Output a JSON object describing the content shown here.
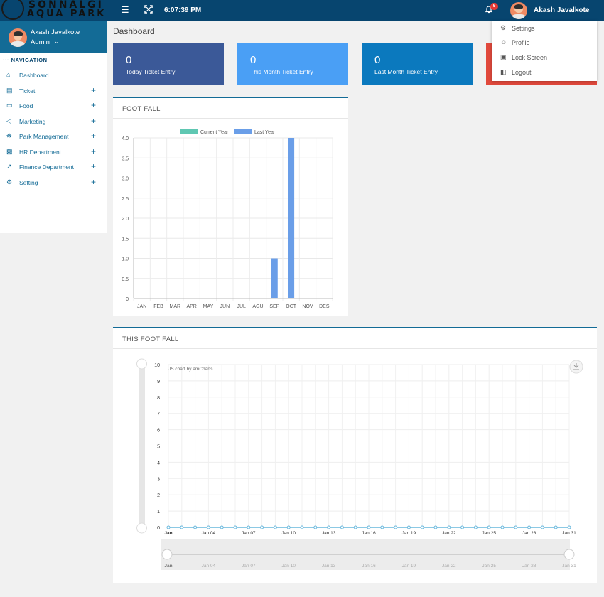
{
  "topbar": {
    "logo_line1": "SONNALGI",
    "logo_line2": "AQUA PARK",
    "menu_icon": "hamburger-icon",
    "expand_icon": "fullscreen-icon",
    "time": "6:07:39 PM",
    "notifications_count": "5",
    "user_name": "Akash Javalkote"
  },
  "sidebar": {
    "user_name": "Akash Javalkote",
    "user_role": "Admin",
    "nav_heading": "NAVIGATION",
    "items": [
      {
        "label": "Dashboard",
        "icon": "home-icon",
        "expandable": false
      },
      {
        "label": "Ticket",
        "icon": "ticket-icon",
        "expandable": true
      },
      {
        "label": "Food",
        "icon": "box-icon",
        "expandable": true
      },
      {
        "label": "Marketing",
        "icon": "megaphone-icon",
        "expandable": true
      },
      {
        "label": "Park Management",
        "icon": "gear-network-icon",
        "expandable": true
      },
      {
        "label": "HR Department",
        "icon": "id-card-icon",
        "expandable": true
      },
      {
        "label": "Finance Department",
        "icon": "chart-line-icon",
        "expandable": true
      },
      {
        "label": "Setting",
        "icon": "gear-icon",
        "expandable": true
      }
    ]
  },
  "user_menu": {
    "items": [
      {
        "label": "Settings",
        "icon": "gear-icon"
      },
      {
        "label": "Profile",
        "icon": "user-icon"
      },
      {
        "label": "Lock Screen",
        "icon": "lock-icon"
      },
      {
        "label": "Logout",
        "icon": "logout-icon"
      }
    ]
  },
  "page": {
    "title": "Dashboard"
  },
  "stats": [
    {
      "value": "0",
      "label": "Today Ticket Entry",
      "color": "#3b5998"
    },
    {
      "value": "0",
      "label": "This Month Ticket Entry",
      "color": "#4a9ff5"
    },
    {
      "value": "0",
      "label": "Last Month Ticket Entry",
      "color": "#0b79be"
    },
    {
      "value": "",
      "label": "",
      "color": "#e1493c"
    }
  ],
  "panels": {
    "foot_fall_title": "FOOT FALL",
    "this_foot_fall_title": "THIS FOOT FALL",
    "credit": "JS chart by amCharts"
  },
  "chart_data": [
    {
      "type": "bar",
      "categories": [
        "JAN",
        "FEB",
        "MAR",
        "APR",
        "MAY",
        "JUN",
        "JUL",
        "AGU",
        "SEP",
        "OCT",
        "NOV",
        "DES"
      ],
      "series": [
        {
          "name": "Current Year",
          "color": "#5fc7b2",
          "values": [
            0,
            0,
            0,
            0,
            0,
            0,
            0,
            0,
            0,
            0,
            0,
            0
          ]
        },
        {
          "name": "Last Year",
          "color": "#6a9ee8",
          "values": [
            0,
            0,
            0,
            0,
            0,
            0,
            0,
            0,
            1,
            4,
            0,
            0
          ]
        }
      ],
      "ylim": [
        0,
        4
      ],
      "yticks": [
        "0",
        "0.5",
        "1.0",
        "1.5",
        "2.0",
        "2.5",
        "3.0",
        "3.5",
        "4.0"
      ],
      "grid": true,
      "legend": "top"
    },
    {
      "type": "line",
      "x": [
        "Jan",
        "Jan 02",
        "Jan 03",
        "Jan 04",
        "Jan 05",
        "Jan 06",
        "Jan 07",
        "Jan 08",
        "Jan 09",
        "Jan 10",
        "Jan 11",
        "Jan 12",
        "Jan 13",
        "Jan 14",
        "Jan 15",
        "Jan 16",
        "Jan 17",
        "Jan 18",
        "Jan 19",
        "Jan 20",
        "Jan 21",
        "Jan 22",
        "Jan 23",
        "Jan 24",
        "Jan 25",
        "Jan 26",
        "Jan 27",
        "Jan 28",
        "Jan 29",
        "Jan 30",
        "Jan 31"
      ],
      "xtick_labels": [
        "Jan",
        "Jan 04",
        "Jan 07",
        "Jan 10",
        "Jan 13",
        "Jan 16",
        "Jan 19",
        "Jan 22",
        "Jan 25",
        "Jan 28",
        "Jan 31"
      ],
      "series": [
        {
          "color": "#67b7dc",
          "values": [
            0,
            0,
            0,
            0,
            0,
            0,
            0,
            0,
            0,
            0,
            0,
            0,
            0,
            0,
            0,
            0,
            0,
            0,
            0,
            0,
            0,
            0,
            0,
            0,
            0,
            0,
            0,
            0,
            0,
            0,
            0
          ]
        }
      ],
      "ylim": [
        0,
        10
      ],
      "yticks": [
        "0",
        "1",
        "2",
        "3",
        "4",
        "5",
        "6",
        "7",
        "8",
        "9",
        "10"
      ],
      "grid": true,
      "scrollbar": true
    }
  ]
}
